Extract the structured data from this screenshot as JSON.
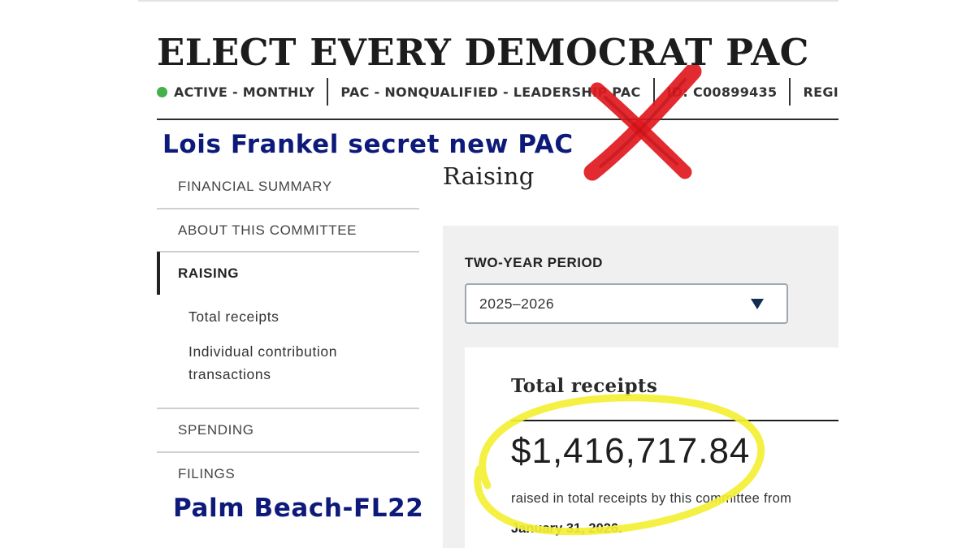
{
  "committee": {
    "title": "ELECT EVERY DEMOCRAT PAC",
    "status": "ACTIVE - MONTHLY",
    "status_color": "#46b04c",
    "type": "PAC - NONQUALIFIED - LEADERSHIP PAC",
    "id": "ID: C00899435",
    "registration": "REGI"
  },
  "annotations": {
    "top_caption": "Lois Frankel secret new PAC",
    "bottom_caption": "Palm Beach-FL22",
    "caption_color": "#0d1a7a",
    "x_mark_color": "#e0191f",
    "circle_color": "#f4ef34"
  },
  "sidebar": {
    "items": [
      {
        "label": "FINANCIAL SUMMARY"
      },
      {
        "label": "ABOUT THIS COMMITTEE"
      },
      {
        "label": "RAISING"
      },
      {
        "label": "SPENDING"
      },
      {
        "label": "FILINGS"
      }
    ],
    "sub_items": [
      {
        "label": "Total receipts"
      },
      {
        "label": "Individual contribution"
      },
      {
        "label": "transactions"
      }
    ]
  },
  "main": {
    "heading": "Raising",
    "period_label": "TWO-YEAR PERIOD",
    "period_selected": "2025–2026",
    "card": {
      "title": "Total receipts",
      "amount": "$1,416,717.84",
      "description": "raised in total receipts by this committee from",
      "date": "January 31, 2026."
    }
  }
}
